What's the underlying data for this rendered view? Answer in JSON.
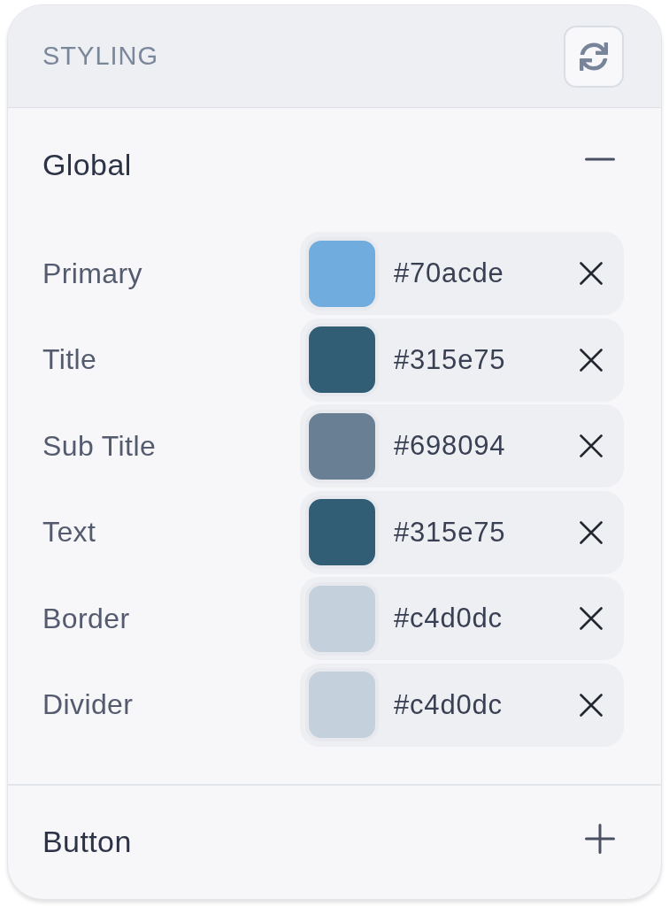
{
  "panel": {
    "title": "STYLING"
  },
  "sections": [
    {
      "title": "Global",
      "expanded": true,
      "fields": [
        {
          "label": "Primary",
          "value": "#70acde",
          "color": "#70acde"
        },
        {
          "label": "Title",
          "value": "#315e75",
          "color": "#315e75"
        },
        {
          "label": "Sub Title",
          "value": "#698094",
          "color": "#698094"
        },
        {
          "label": "Text",
          "value": "#315e75",
          "color": "#315e75"
        },
        {
          "label": "Border",
          "value": "#c4d0dc",
          "color": "#c4d0dc"
        },
        {
          "label": "Divider",
          "value": "#c4d0dc",
          "color": "#c4d0dc"
        }
      ]
    },
    {
      "title": "Button",
      "expanded": false
    }
  ]
}
